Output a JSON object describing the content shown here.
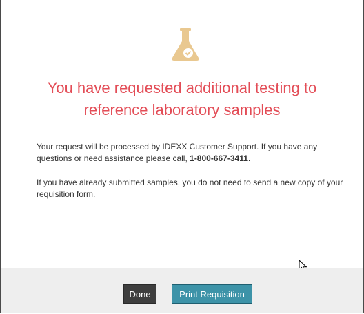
{
  "dialog": {
    "icon": "flask-check-icon",
    "title_line1": "You have requested additional testing to",
    "title_line2": "reference laboratory samples",
    "message1_text": "Your request will be processed by IDEXX Customer Support. If you have any questions or need assistance please call, ",
    "message1_phone": "1-800-667-3411",
    "message1_end": ".",
    "message2": "If you have already submitted samples, you do not need to send a new copy of your requisition form."
  },
  "footer": {
    "done_label": "Done",
    "print_label": "Print Requisition"
  },
  "colors": {
    "title": "#e34d57",
    "icon": "#e9c890",
    "done_button": "#3e3e3e",
    "print_button": "#3d93a8",
    "footer_bg": "#eeeeee"
  }
}
